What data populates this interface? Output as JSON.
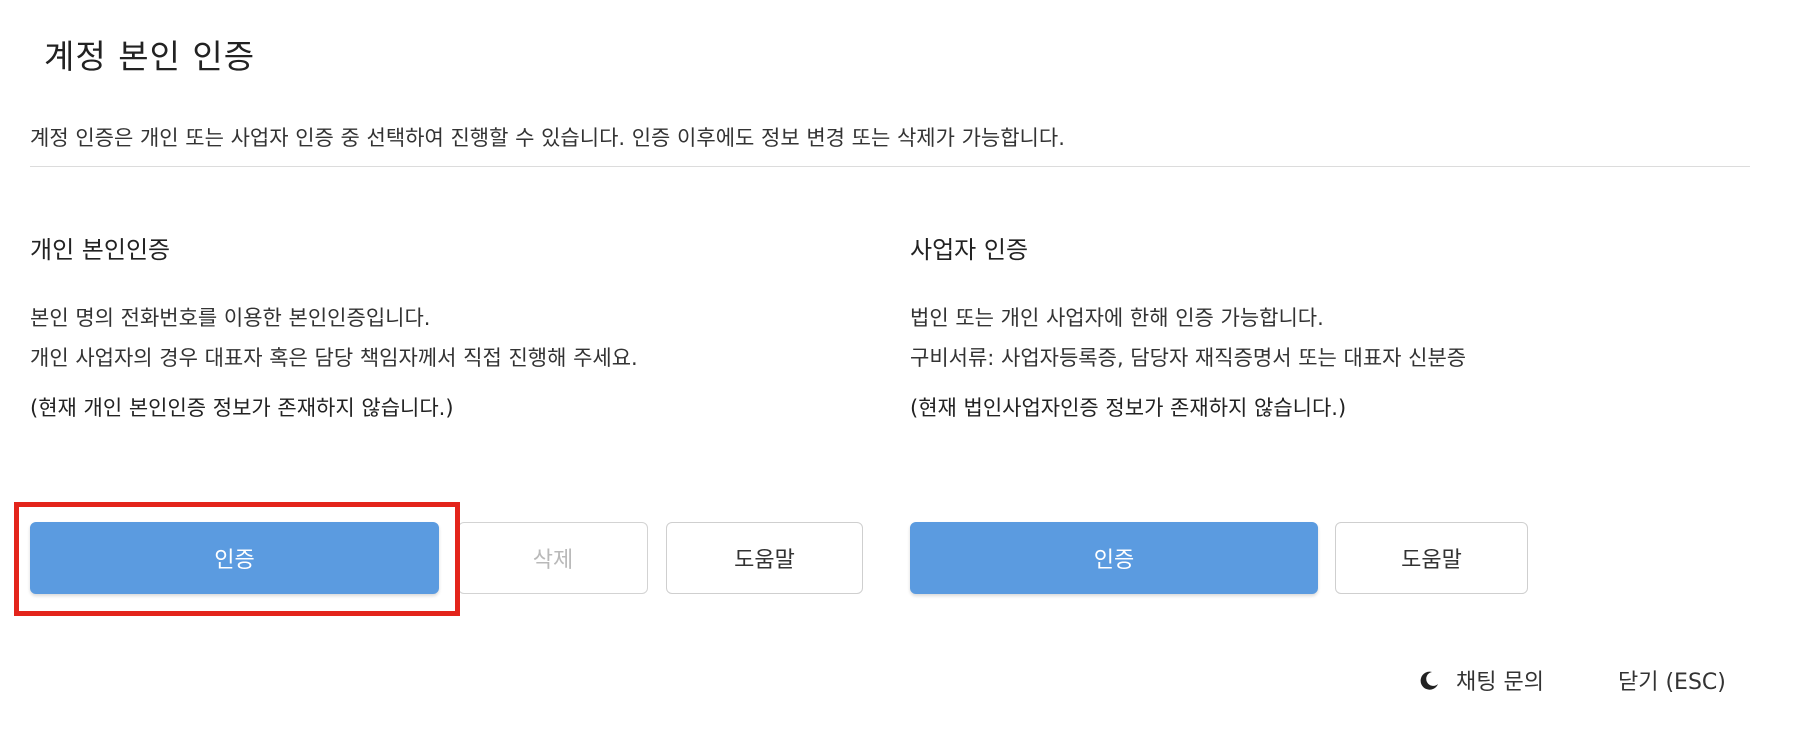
{
  "dialog": {
    "title": "계정 본인 인증",
    "description": "계정 인증은 개인 또는 사업자 인증 중 선택하여 진행할 수 있습니다. 인증 이후에도 정보 변경 또는 삭제가 가능합니다."
  },
  "personal": {
    "title": "개인 본인인증",
    "line1": "본인 명의 전화번호를 이용한 본인인증입니다.",
    "line2": "개인 사업자의 경우 대표자 혹은 담당 책임자께서 직접 진행해 주세요.",
    "note": "(현재 개인 본인인증 정보가 존재하지 않습니다.)",
    "verify_label": "인증",
    "delete_label": "삭제",
    "help_label": "도움말"
  },
  "business": {
    "title": "사업자 인증",
    "line1": "법인 또는 개인 사업자에 한해 인증 가능합니다.",
    "line2": "구비서류: 사업자등록증, 담당자 재직증명서 또는 대표자 신분증",
    "note": "(현재 법인사업자인증 정보가 존재하지 않습니다.)",
    "verify_label": "인증",
    "help_label": "도움말"
  },
  "footer": {
    "chat_label": "채팅 문의",
    "close_label": "닫기 (ESC)",
    "chat_icon": "moon-icon"
  },
  "colors": {
    "primary": "#5b9be0",
    "highlight": "#e3241b"
  }
}
